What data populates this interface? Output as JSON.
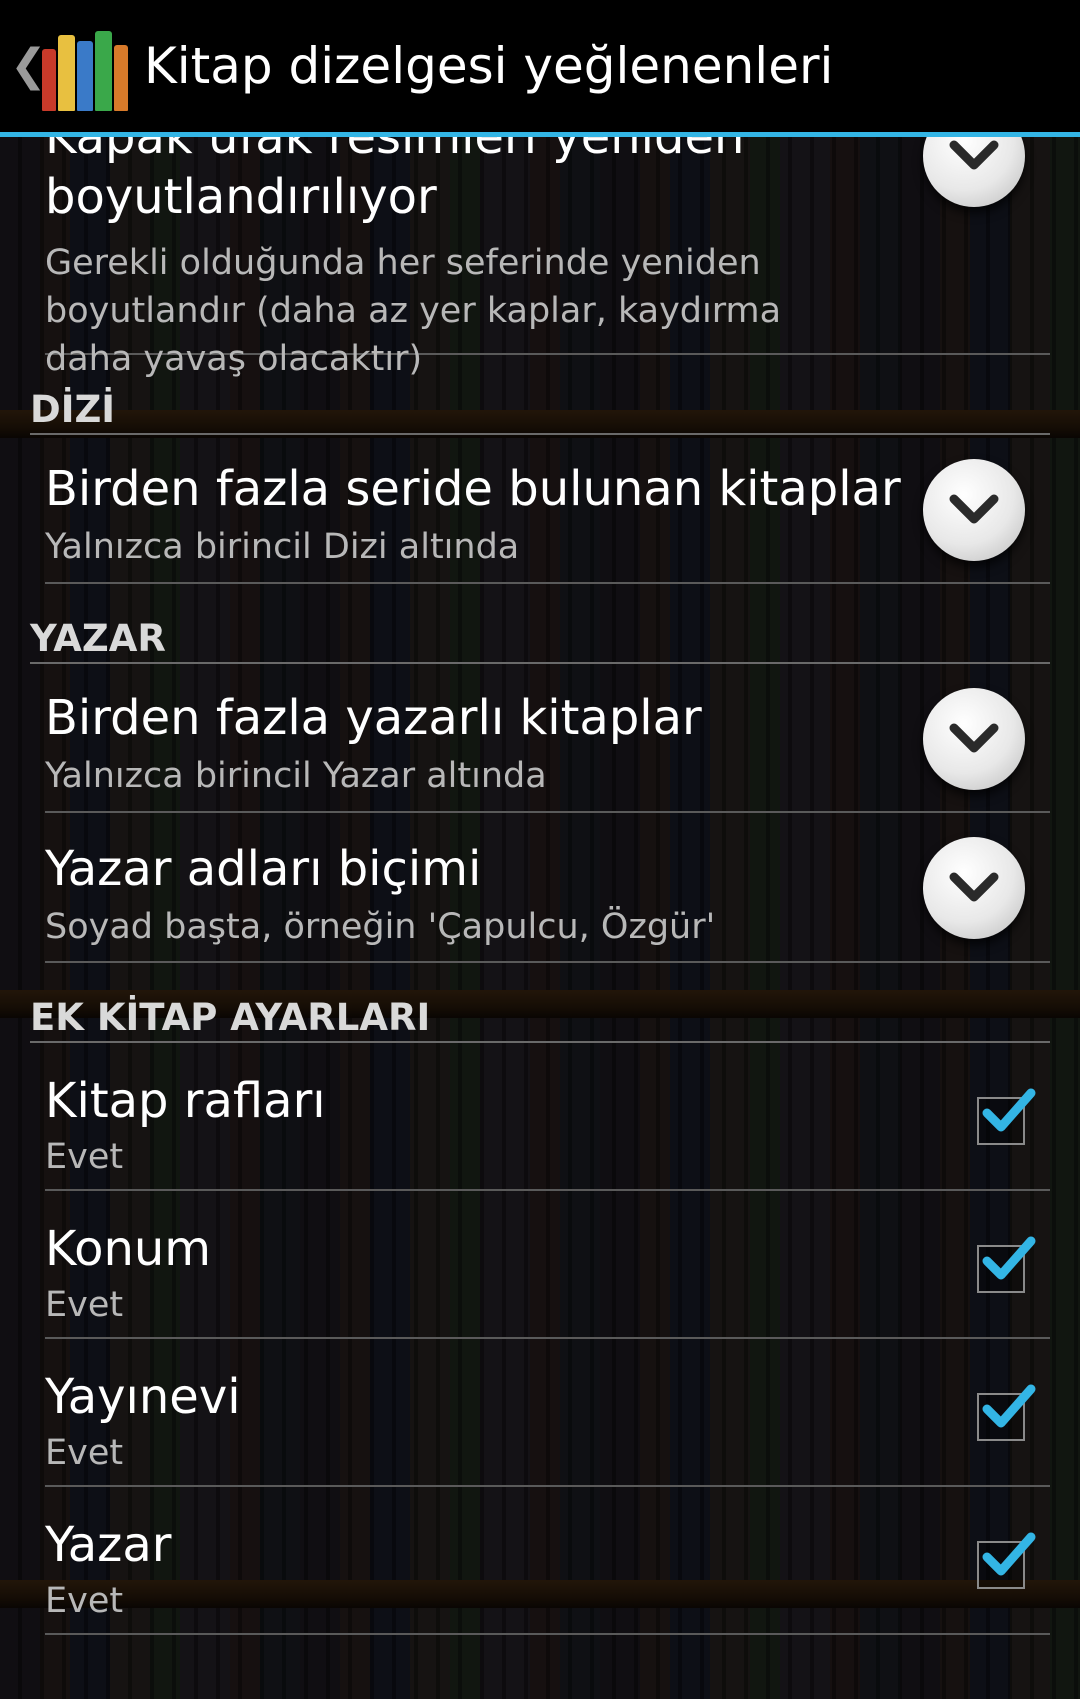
{
  "actionbar": {
    "title": "Kitap dizelgesi yeğlenenleri",
    "up_glyph": "❮",
    "app_icon": "bookshelf-app-icon",
    "accent_color": "#33b5e5"
  },
  "items": {
    "cover_resize": {
      "title_line1": "Kapak ufak resimleri yeniden",
      "title_line2": "boyutlandırılıyor",
      "summary": "Gerekli olduğunda her seferinde yeniden boyutlandır (daha az yer kaplar, kaydırma daha yavaş olacaktır)"
    },
    "series_multi": {
      "title": "Birden fazla seride bulunan kitaplar",
      "summary": "Yalnızca birincil Dizi altında"
    },
    "author_multi": {
      "title": "Birden fazla yazarlı kitaplar",
      "summary": "Yalnızca birincil Yazar altında"
    },
    "author_format": {
      "title": "Yazar adları biçimi",
      "summary": "Soyad başta, örneğin 'Çapulcu, Özgür'"
    },
    "bookshelves": {
      "title": "Kitap rafları",
      "summary": "Evet",
      "checked": true
    },
    "location": {
      "title": "Konum",
      "summary": "Evet",
      "checked": true
    },
    "publisher": {
      "title": "Yayınevi",
      "summary": "Evet",
      "checked": true
    },
    "author": {
      "title": "Yazar",
      "summary": "Evet",
      "checked": true
    }
  },
  "headers": {
    "series": "DİZİ",
    "author": "YAZAR",
    "extra": "EK KİTAP AYARLARI"
  },
  "colors": {
    "checkmark": "#33b5e5",
    "divider": "#5a5a5a"
  }
}
